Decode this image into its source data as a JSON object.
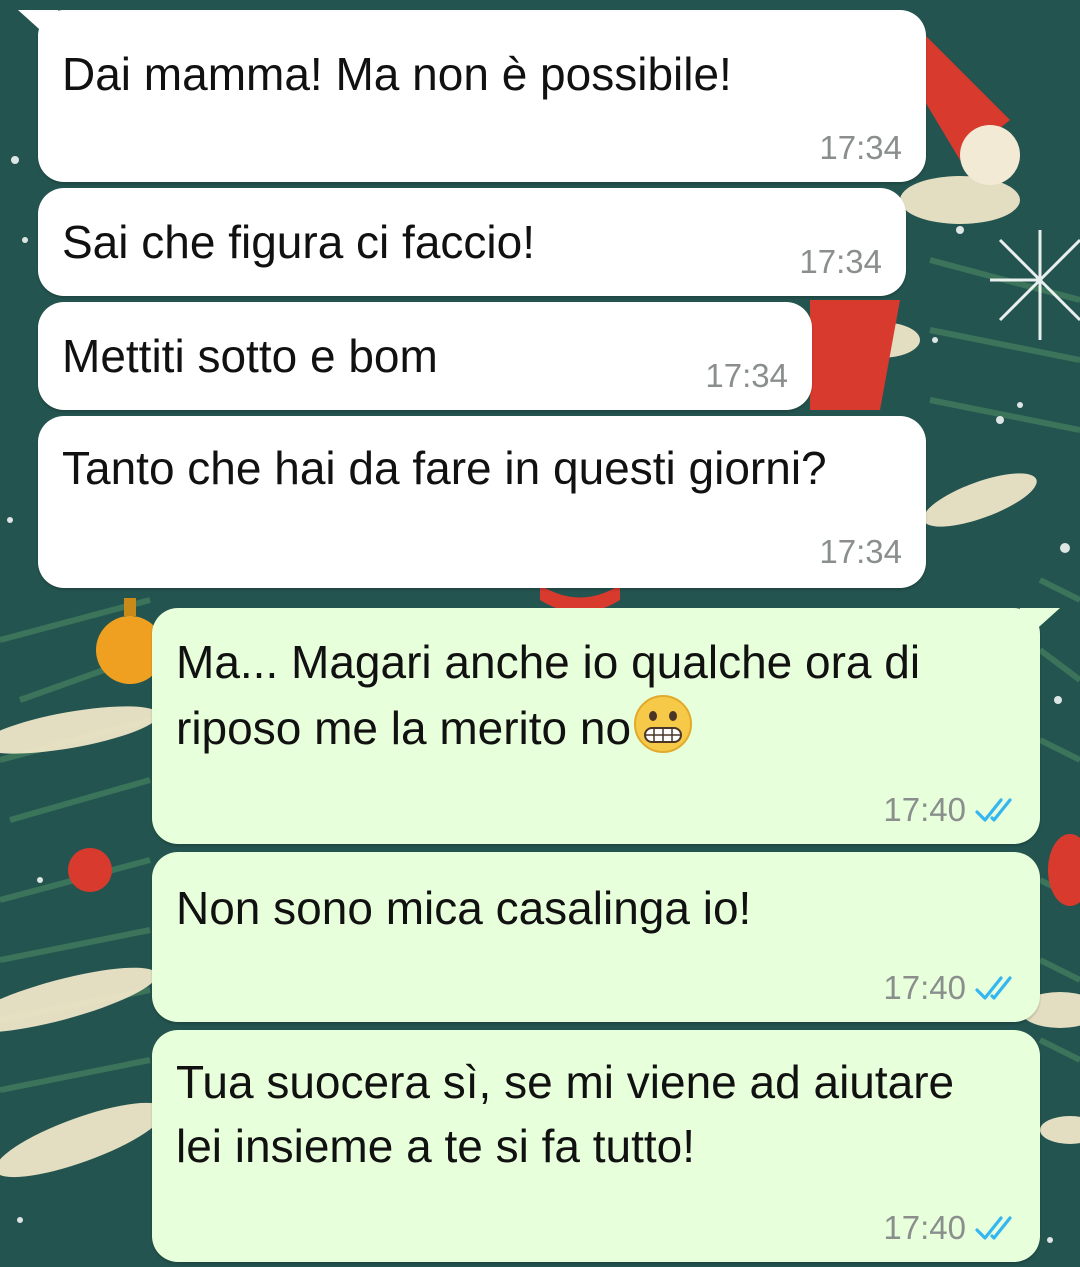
{
  "colors": {
    "incoming_bubble": "#ffffff",
    "outgoing_bubble": "#e7ffdb",
    "timestamp": "#8a8f8d",
    "read_ticks": "#34b7f1",
    "wallpaper": "#24544f"
  },
  "messages": [
    {
      "direction": "incoming",
      "text": "Dai mamma! Ma non è possibile!",
      "time": "17:34"
    },
    {
      "direction": "incoming",
      "text": "Sai che figura ci faccio!",
      "time": "17:34"
    },
    {
      "direction": "incoming",
      "text": "Mettiti sotto e bom",
      "time": "17:34"
    },
    {
      "direction": "incoming",
      "text": "Tanto che hai da fare in questi giorni?",
      "time": "17:34"
    },
    {
      "direction": "outgoing",
      "text": "Ma... Magari anche io qualche ora di riposo me la merito no",
      "emoji": "grimacing-face",
      "time": "17:40",
      "status": "read"
    },
    {
      "direction": "outgoing",
      "text": "Non sono mica casalinga io!",
      "time": "17:40",
      "status": "read"
    },
    {
      "direction": "outgoing",
      "text": "Tua suocera sì, se mi viene ad aiutare lei insieme a te si fa tutto!",
      "time": "17:40",
      "status": "read"
    }
  ]
}
